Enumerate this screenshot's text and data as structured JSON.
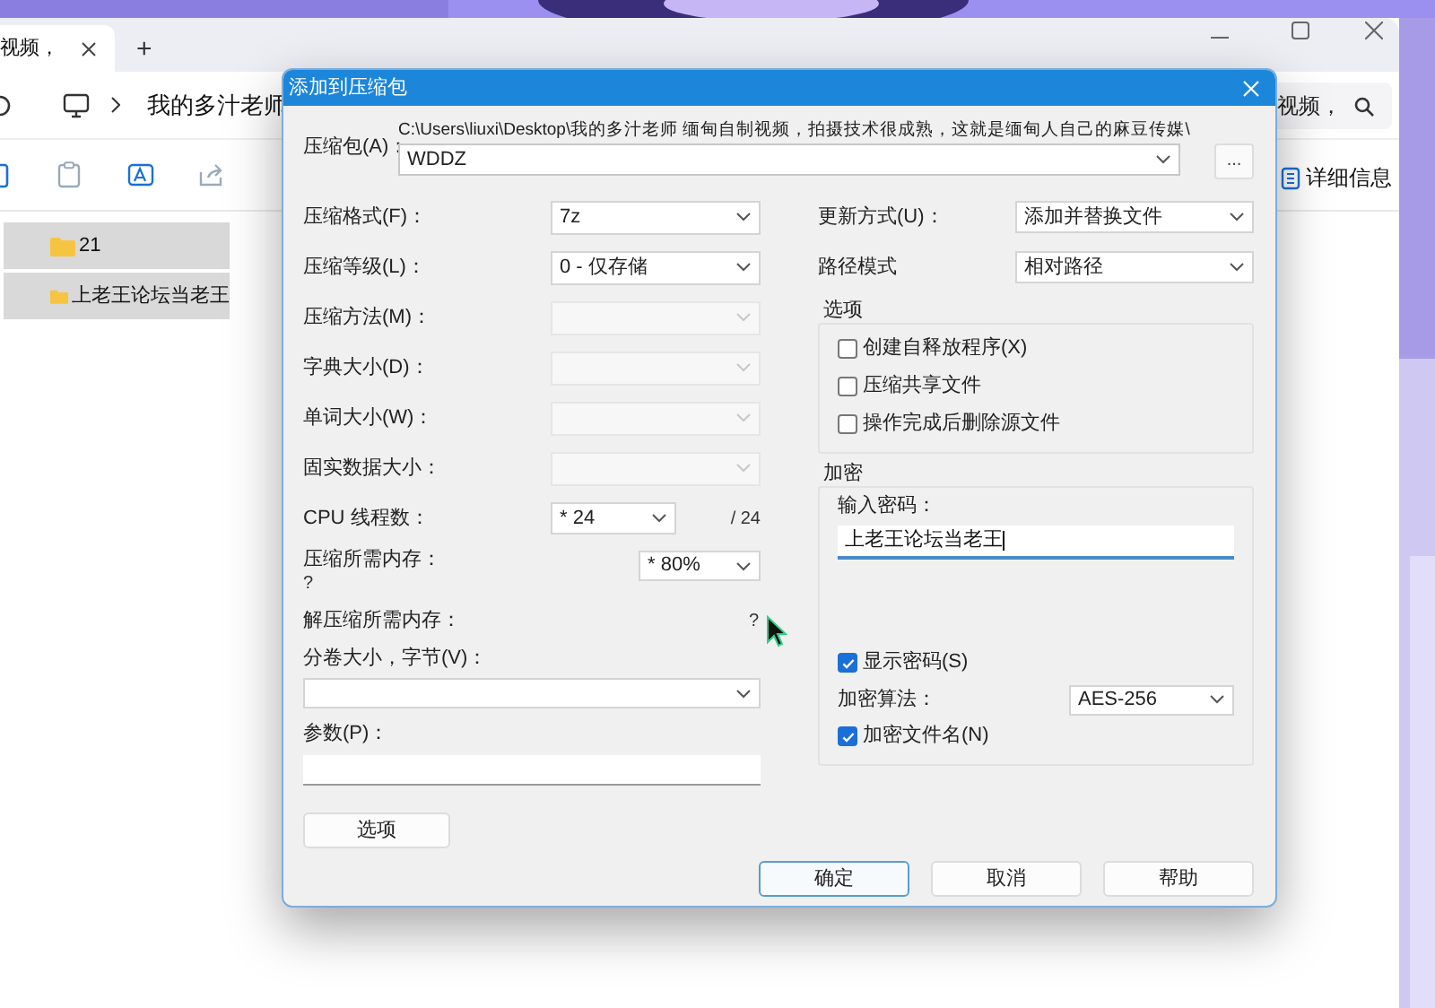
{
  "explorer": {
    "tab_title": "视频，",
    "new_tab": "+",
    "address_path": "我的多汁老师",
    "address_tail": "视频，",
    "details_button": "详细信息",
    "files": [
      {
        "name": "21",
        "selected": true
      },
      {
        "name": "上老王论坛当老王",
        "selected": true
      }
    ]
  },
  "dialog": {
    "title": "添加到压缩包",
    "archive": {
      "label": "压缩包(A)：",
      "path": "C:\\Users\\liuxi\\Desktop\\我的多汁老师 缅甸自制视频，拍摄技术很成熟，这就是缅甸人自己的麻豆传媒\\",
      "value": "WDDZ",
      "browse": "..."
    },
    "left_fields": [
      {
        "kind": "select",
        "label": "压缩格式(F)：",
        "value": "7z",
        "disabled": false
      },
      {
        "kind": "select",
        "label": "压缩等级(L)：",
        "value": "0 - 仅存储",
        "disabled": false
      },
      {
        "kind": "select",
        "label": "压缩方法(M)：",
        "disabled": true
      },
      {
        "kind": "select",
        "label": "字典大小(D)：",
        "disabled": true
      },
      {
        "kind": "select",
        "label": "单词大小(W)：",
        "disabled": true
      },
      {
        "kind": "select",
        "label": "固实数据大小：",
        "disabled": true
      },
      {
        "kind": "threads",
        "label": "CPU 线程数：",
        "value": "* 24",
        "suffix": "/ 24",
        "disabled": false
      },
      {
        "kind": "memory",
        "label": "压缩所需内存：",
        "note": "?",
        "value": "* 80%",
        "disabled": false
      },
      {
        "kind": "readout",
        "label": "解压缩所需内存：",
        "value": "?"
      },
      {
        "kind": "combo_below",
        "label": "分卷大小，字节(V)：",
        "disabled": false
      },
      {
        "kind": "input_below",
        "label": "参数(P)："
      }
    ],
    "options_button": "选项",
    "right_fields": [
      {
        "label": "更新方式(U)：",
        "value": "添加并替换文件"
      },
      {
        "label": "路径模式",
        "value": "相对路径"
      }
    ],
    "options_group": {
      "title": "选项",
      "items": [
        {
          "label": "创建自释放程序(X)",
          "checked": false
        },
        {
          "label": "压缩共享文件",
          "checked": false
        },
        {
          "label": "操作完成后删除源文件",
          "checked": false
        }
      ]
    },
    "encryption": {
      "title": "加密",
      "password_label": "输入密码：",
      "password": "上老王论坛当老王",
      "show_password": {
        "label": "显示密码(S)",
        "checked": true
      },
      "method_label": "加密算法：",
      "method": "AES-256",
      "encrypt_names": {
        "label": "加密文件名(N)",
        "checked": true
      }
    },
    "buttons": [
      {
        "label": "确定",
        "focused": true
      },
      {
        "label": "取消",
        "focused": false
      },
      {
        "label": "帮助",
        "focused": false
      }
    ]
  }
}
